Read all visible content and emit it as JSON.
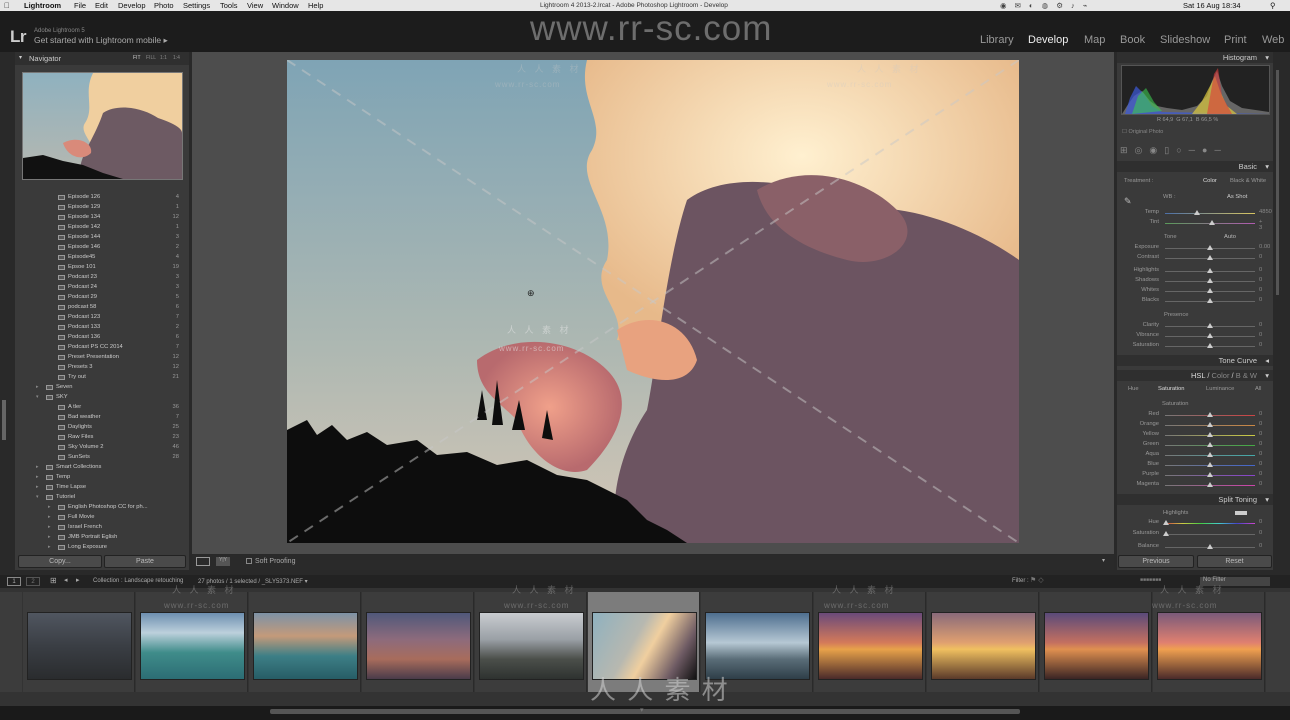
{
  "menubar": {
    "app": "Lightroom",
    "items": [
      "File",
      "Edit",
      "Develop",
      "Photo",
      "Settings",
      "Tools",
      "View",
      "Window",
      "Help"
    ],
    "window_title": "Lightroom 4 2013-2.lrcat - Adobe Photoshop Lightroom - Develop",
    "clock": "Sat 16 Aug  18:34"
  },
  "header": {
    "logo": "Lr",
    "product": "Adobe Lightroom 5",
    "tagline": "Get started with Lightroom mobile",
    "tagline_arrow": "▸",
    "modules": [
      "Library",
      "Develop",
      "Map",
      "Book",
      "Slideshow",
      "Print",
      "Web"
    ],
    "active_module": "Develop",
    "watermark": "www.rr-sc.com"
  },
  "navigator": {
    "title": "Navigator",
    "zoom_options": [
      "FIT",
      "FILL",
      "1:1",
      "1:4"
    ]
  },
  "folders": [
    {
      "name": "Episode 126",
      "count": "4",
      "level": 2
    },
    {
      "name": "Episode 129",
      "count": "1",
      "level": 2
    },
    {
      "name": "Episode 134",
      "count": "12",
      "level": 2
    },
    {
      "name": "Episode 142",
      "count": "1",
      "level": 2
    },
    {
      "name": "Episode 144",
      "count": "3",
      "level": 2
    },
    {
      "name": "Episode 146",
      "count": "2",
      "level": 2
    },
    {
      "name": "Episode45",
      "count": "4",
      "level": 2
    },
    {
      "name": "Epsoe 101",
      "count": "19",
      "level": 2
    },
    {
      "name": "Podcast 23",
      "count": "3",
      "level": 2
    },
    {
      "name": "Podcast 24",
      "count": "3",
      "level": 2
    },
    {
      "name": "Podcast 29",
      "count": "5",
      "level": 2
    },
    {
      "name": "podcast 58",
      "count": "6",
      "level": 2
    },
    {
      "name": "Podcast 123",
      "count": "7",
      "level": 2
    },
    {
      "name": "Podcast 133",
      "count": "2",
      "level": 2
    },
    {
      "name": "Podcast 136",
      "count": "6",
      "level": 2
    },
    {
      "name": "Podcast PS CC 2014",
      "count": "7",
      "level": 2
    },
    {
      "name": "Preset Presentation",
      "count": "12",
      "level": 2
    },
    {
      "name": "Presets 3",
      "count": "12",
      "level": 2
    },
    {
      "name": "Try out",
      "count": "21",
      "level": 2
    },
    {
      "name": "Seven",
      "count": "",
      "level": 1,
      "tri": "▸"
    },
    {
      "name": "SKY",
      "count": "",
      "level": 1,
      "tri": "▾"
    },
    {
      "name": "A tler",
      "count": "36",
      "level": 2
    },
    {
      "name": "Bad weather",
      "count": "7",
      "level": 2
    },
    {
      "name": "Daylights",
      "count": "25",
      "level": 2
    },
    {
      "name": "Raw Files",
      "count": "23",
      "level": 2
    },
    {
      "name": "Sky Volume 2",
      "count": "46",
      "level": 2
    },
    {
      "name": "SunSets",
      "count": "28",
      "level": 2
    },
    {
      "name": "Smart Collections",
      "count": "",
      "level": 1,
      "tri": "▸"
    },
    {
      "name": "Temp",
      "count": "",
      "level": 1,
      "tri": "▸"
    },
    {
      "name": "Time Lapse",
      "count": "",
      "level": 1,
      "tri": "▸"
    },
    {
      "name": "Tutoriel",
      "count": "",
      "level": 1,
      "tri": "▾"
    },
    {
      "name": "English Photoshop CC for ph...",
      "count": "",
      "level": 2,
      "tri": "▸"
    },
    {
      "name": "Full Movie",
      "count": "",
      "level": 2,
      "tri": "▸"
    },
    {
      "name": "Israel French",
      "count": "",
      "level": 2,
      "tri": "▸"
    },
    {
      "name": "JMB Portrait Eglish",
      "count": "",
      "level": 2,
      "tri": "▸"
    },
    {
      "name": "Long Exposure",
      "count": "",
      "level": 2,
      "tri": "▸"
    }
  ],
  "left_buttons": {
    "copy": "Copy...",
    "paste": "Paste"
  },
  "toolbar": {
    "soft_proofing": "Soft Proofing"
  },
  "histogram": {
    "title": "Histogram",
    "readout": {
      "r_label": "R",
      "r": "64,9",
      "g_label": "G",
      "g": "67,1",
      "b_label": "B",
      "b": "66,5",
      "unit": "%"
    },
    "original_photo": "Original Photo"
  },
  "basic": {
    "title": "Basic",
    "treatment_label": "Treatment :",
    "treatment_color": "Color",
    "treatment_bw": "Black & White",
    "wb_label": "WB :",
    "wb_value": "As Shot",
    "tone_label": "Tone",
    "tone_auto": "Auto",
    "presence_label": "Presence",
    "sliders": [
      {
        "label": "Temp",
        "value": "4850",
        "pos": 0.35
      },
      {
        "label": "Tint",
        "value": "+ 3",
        "pos": 0.52
      },
      {
        "label": "Exposure",
        "value": "0.00",
        "pos": 0.5
      },
      {
        "label": "Contrast",
        "value": "0",
        "pos": 0.5
      },
      {
        "label": "Highlights",
        "value": "0",
        "pos": 0.5
      },
      {
        "label": "Shadows",
        "value": "0",
        "pos": 0.5
      },
      {
        "label": "Whites",
        "value": "0",
        "pos": 0.5
      },
      {
        "label": "Blacks",
        "value": "0",
        "pos": 0.5
      },
      {
        "label": "Clarity",
        "value": "0",
        "pos": 0.5
      },
      {
        "label": "Vibrance",
        "value": "0",
        "pos": 0.5
      },
      {
        "label": "Saturation",
        "value": "0",
        "pos": 0.5
      }
    ]
  },
  "tone_curve": {
    "title": "Tone Curve"
  },
  "hsl": {
    "title_hsl": "HSL",
    "title_color": "Color",
    "title_bw": "B & W",
    "tabs": [
      "Hue",
      "Saturation",
      "Luminance",
      "All"
    ],
    "active_tab": "Saturation",
    "group_label": "Saturation",
    "sliders": [
      {
        "label": "Red",
        "value": "0",
        "color": "#c44"
      },
      {
        "label": "Orange",
        "value": "0",
        "color": "#c84"
      },
      {
        "label": "Yellow",
        "value": "0",
        "color": "#cc4"
      },
      {
        "label": "Green",
        "value": "0",
        "color": "#4a4"
      },
      {
        "label": "Aqua",
        "value": "0",
        "color": "#4aa"
      },
      {
        "label": "Blue",
        "value": "0",
        "color": "#46c"
      },
      {
        "label": "Purple",
        "value": "0",
        "color": "#84c"
      },
      {
        "label": "Magenta",
        "value": "0",
        "color": "#c4a"
      }
    ]
  },
  "split_toning": {
    "title": "Split Toning",
    "highlights_label": "Highlights",
    "hue_label": "Hue",
    "hue_value": "0",
    "saturation_label": "Saturation",
    "saturation_value": "0",
    "balance_label": "Balance",
    "balance_value": "0"
  },
  "right_buttons": {
    "previous": "Previous",
    "reset": "Reset"
  },
  "filmstrip": {
    "screen1": "1",
    "screen2": "2",
    "collection": "Collection : Landscape retouching",
    "count": "27 photos / 1 selected / _SLY5373.NEF ▾",
    "filter_label": "Filter :",
    "filter_value": "No Filter"
  },
  "watermarks": {
    "cn": "人 人 素 材",
    "url": "www.rr-sc.com"
  }
}
